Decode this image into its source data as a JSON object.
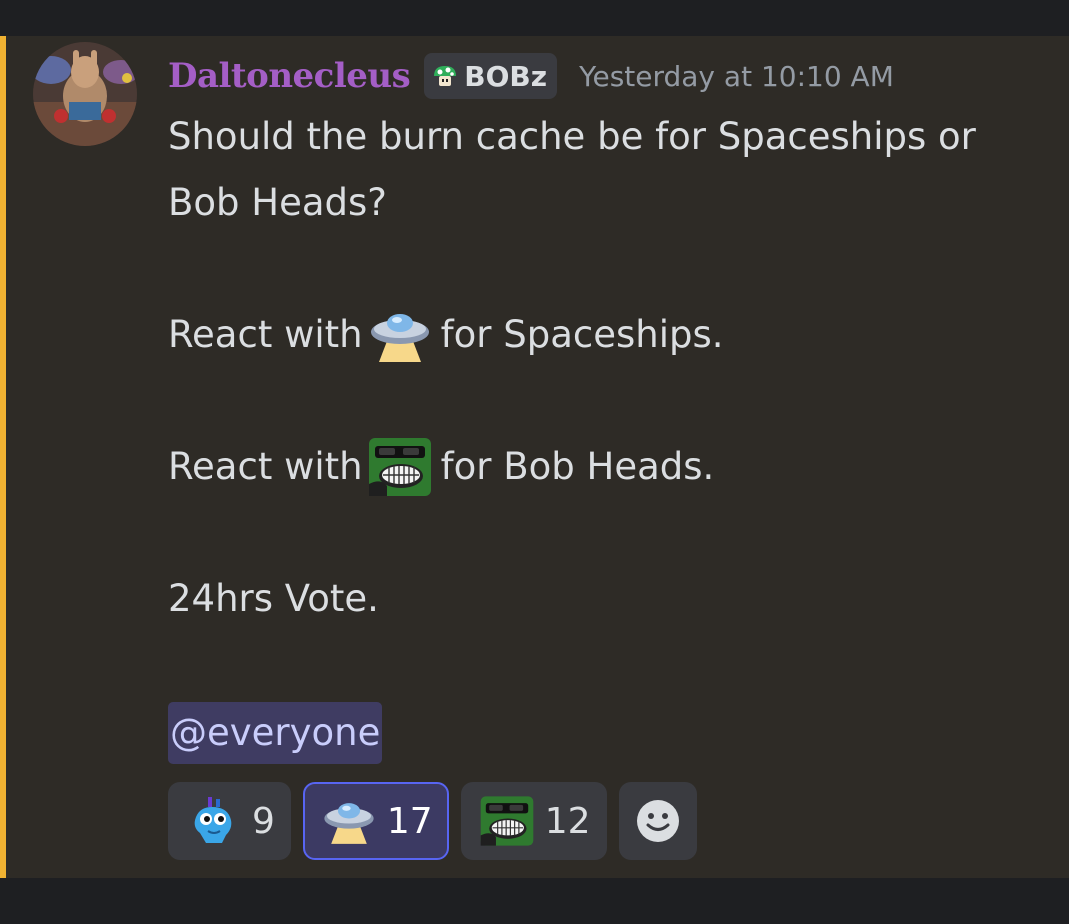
{
  "message": {
    "author": {
      "username": "Daltonecleus",
      "role": "BOBz",
      "role_icon": "green-mushroom-icon"
    },
    "timestamp": "Yesterday at 10:10 AM",
    "lines": {
      "l1": "Should the burn cache be for Spaceships or",
      "l2": "Bob Heads?",
      "react1_pre": "React with",
      "react1_post": "for Spaceships.",
      "react2_pre": "React with",
      "react2_post": "for Bob Heads.",
      "vote": "24hrs Vote."
    },
    "mention": "@everyone",
    "colors": {
      "username": "#a45ec6",
      "mention_bar": "#f0b232",
      "active_reaction_border": "#5865f2"
    }
  },
  "reactions": [
    {
      "emoji": "blue-alien-emoji",
      "count": "9",
      "active": false
    },
    {
      "emoji": "ufo-emoji",
      "count": "17",
      "active": true
    },
    {
      "emoji": "green-sunglasses-face-emoji",
      "count": "12",
      "active": false
    }
  ],
  "add_reaction": {
    "icon": "smiley-icon"
  }
}
